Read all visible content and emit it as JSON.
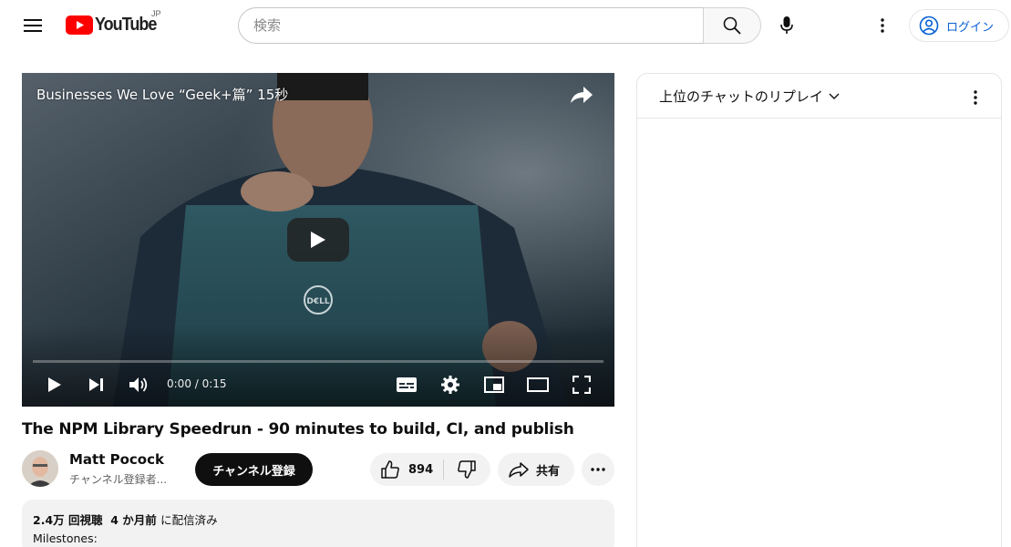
{
  "masthead": {
    "logo_text": "YouTube",
    "country_code": "JP",
    "search_placeholder": "検索",
    "login_label": "ログイン"
  },
  "player": {
    "overlay_title": "Businesses We Love “Geek+篇” 15秒",
    "time_display": "0:00 / 0:15",
    "progress": 0
  },
  "video": {
    "title": "The NPM Library Speedrun - 90 minutes to build, CI, and publish"
  },
  "channel": {
    "name": "Matt Pocock",
    "subscribers": "チャンネル登録者...",
    "subscribe_label": "チャンネル登録"
  },
  "actions": {
    "like_count": "894",
    "share_label": "共有"
  },
  "description": {
    "views": "2.4万 回視聴",
    "published": "4 か月前",
    "published_suffix": "に配信済み",
    "first_line": "Milestones:"
  },
  "chat": {
    "mode_label": "上位のチャットのリプレイ"
  },
  "colors": {
    "brand_red": "#ff0000",
    "link_blue": "#065fd4",
    "chip_bg": "#f2f2f2"
  }
}
